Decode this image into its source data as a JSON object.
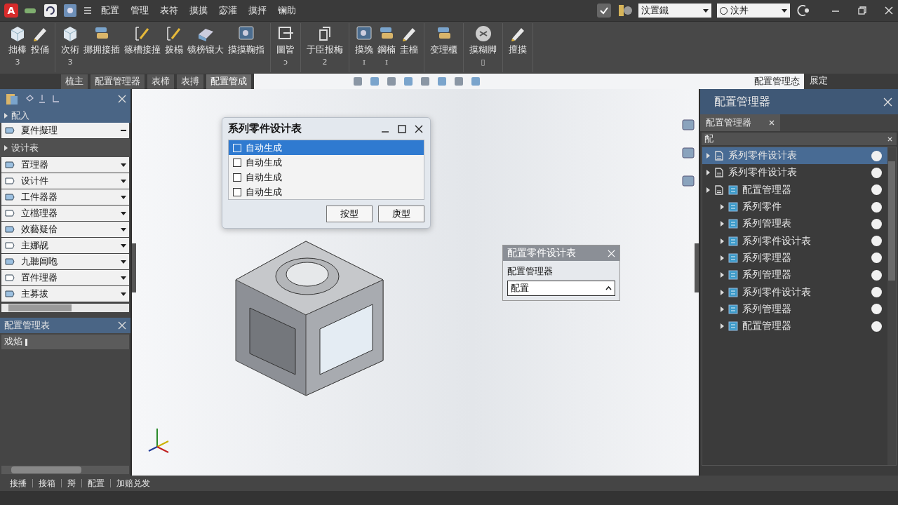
{
  "app_logo": "A",
  "menu_bar": {
    "items": [
      "配置",
      "管理",
      "表符",
      "摸摸",
      "宓灌",
      "摸抨",
      "镧助"
    ],
    "dropdowns": [
      "汶置鐵",
      "汶丼"
    ]
  },
  "ribbon": {
    "groups": [
      {
        "tools": [
          {
            "label": "拙棒",
            "sub": "3",
            "kind": "box"
          },
          {
            "label": "投俑",
            "kind": "pen"
          }
        ]
      },
      {
        "tools": [
          {
            "label": "次術",
            "sub": "3",
            "kind": "box"
          },
          {
            "label": "挪拥接插",
            "kind": "stack"
          },
          {
            "label": "篠槽接撞",
            "kind": "sketch"
          },
          {
            "label": "拨榻",
            "kind": "sketch"
          },
          {
            "label": "镜榜镶大",
            "kind": "plate"
          },
          {
            "label": "摸摸鞠指",
            "kind": "screen"
          }
        ]
      },
      {
        "tools": [
          {
            "label": "圖皆",
            "sub": "ɔ",
            "kind": "frame"
          }
        ]
      },
      {
        "tools": [
          {
            "label": "于臣报梅",
            "sub": "2",
            "kind": "doc"
          }
        ]
      },
      {
        "tools": [
          {
            "label": "摸堍",
            "sub": "ɪ",
            "kind": "screen"
          },
          {
            "label": "鋼楠",
            "sub": "ɪ",
            "kind": "stack"
          },
          {
            "label": "圭檣",
            "kind": "pen"
          }
        ]
      },
      {
        "tools": [
          {
            "label": "变理櫃",
            "kind": "stack"
          }
        ]
      },
      {
        "tools": [
          {
            "label": "摸糊脚",
            "sub": "▯",
            "kind": "circle"
          }
        ]
      },
      {
        "tools": [
          {
            "label": "擅摸",
            "kind": "pen"
          }
        ]
      }
    ]
  },
  "doc_tabs": [
    {
      "label": "梳主",
      "selected": false
    },
    {
      "label": "配置管理器",
      "selected": false
    },
    {
      "label": "表楴",
      "selected": false
    },
    {
      "label": "表搏",
      "selected": false
    },
    {
      "label": "配置管成",
      "selected": true
    }
  ],
  "view_status": "配置管理态",
  "right_tab": "展定",
  "left_panel": {
    "sections": [
      {
        "title": "配入",
        "kind": "blue",
        "items": [
          {
            "label": "夏件擬理"
          }
        ]
      },
      {
        "title": "设计表",
        "kind": "dark",
        "items": [
          {
            "label": "置理器"
          },
          {
            "label": "设计件"
          },
          {
            "label": "工件器器"
          },
          {
            "label": "立檔理器"
          },
          {
            "label": "效藝疑佮"
          },
          {
            "label": "主娜觇"
          },
          {
            "label": "九聽阊咆"
          },
          {
            "label": "置件理器"
          },
          {
            "label": "主募拔"
          }
        ]
      }
    ],
    "bottom_title": "配置管理表",
    "bottom_field": "戏焰"
  },
  "dialog": {
    "title": "系列零件设计表",
    "rows": [
      {
        "label": "自动生成",
        "checked": false,
        "selected": true
      },
      {
        "label": "自动生成",
        "checked": false,
        "selected": false
      },
      {
        "label": "自动生成",
        "checked": false,
        "selected": false
      },
      {
        "label": "自动生成",
        "checked": false,
        "selected": false
      }
    ],
    "buttons": [
      "按型",
      "庚型"
    ]
  },
  "mini_panel": {
    "title": "配置零件设计表",
    "label": "配置管理器",
    "value": "配置"
  },
  "right_panel": {
    "title": "配置管理器",
    "tab": "配置管理器",
    "filter": "配",
    "tree": [
      {
        "label": "系列零件设计表",
        "selected": true
      },
      {
        "label": "系列零件设计表",
        "selected": false
      },
      {
        "label": "配置管理器",
        "selected": false,
        "children": [
          {
            "label": "系列零件",
            "selected": false
          },
          {
            "label": "系列管理表",
            "selected": false
          },
          {
            "label": "系列零件设计表",
            "selected": false
          },
          {
            "label": "系列零理器",
            "selected": false
          },
          {
            "label": "系列管理器",
            "selected": false
          },
          {
            "label": "系列零件设计表",
            "selected": false
          },
          {
            "label": "系列管理器",
            "selected": false
          },
          {
            "label": "配置管理器",
            "selected": false
          }
        ]
      }
    ]
  },
  "status_bar": [
    "接播",
    "接箱",
    "搿",
    "配置",
    "加赔兑发"
  ]
}
